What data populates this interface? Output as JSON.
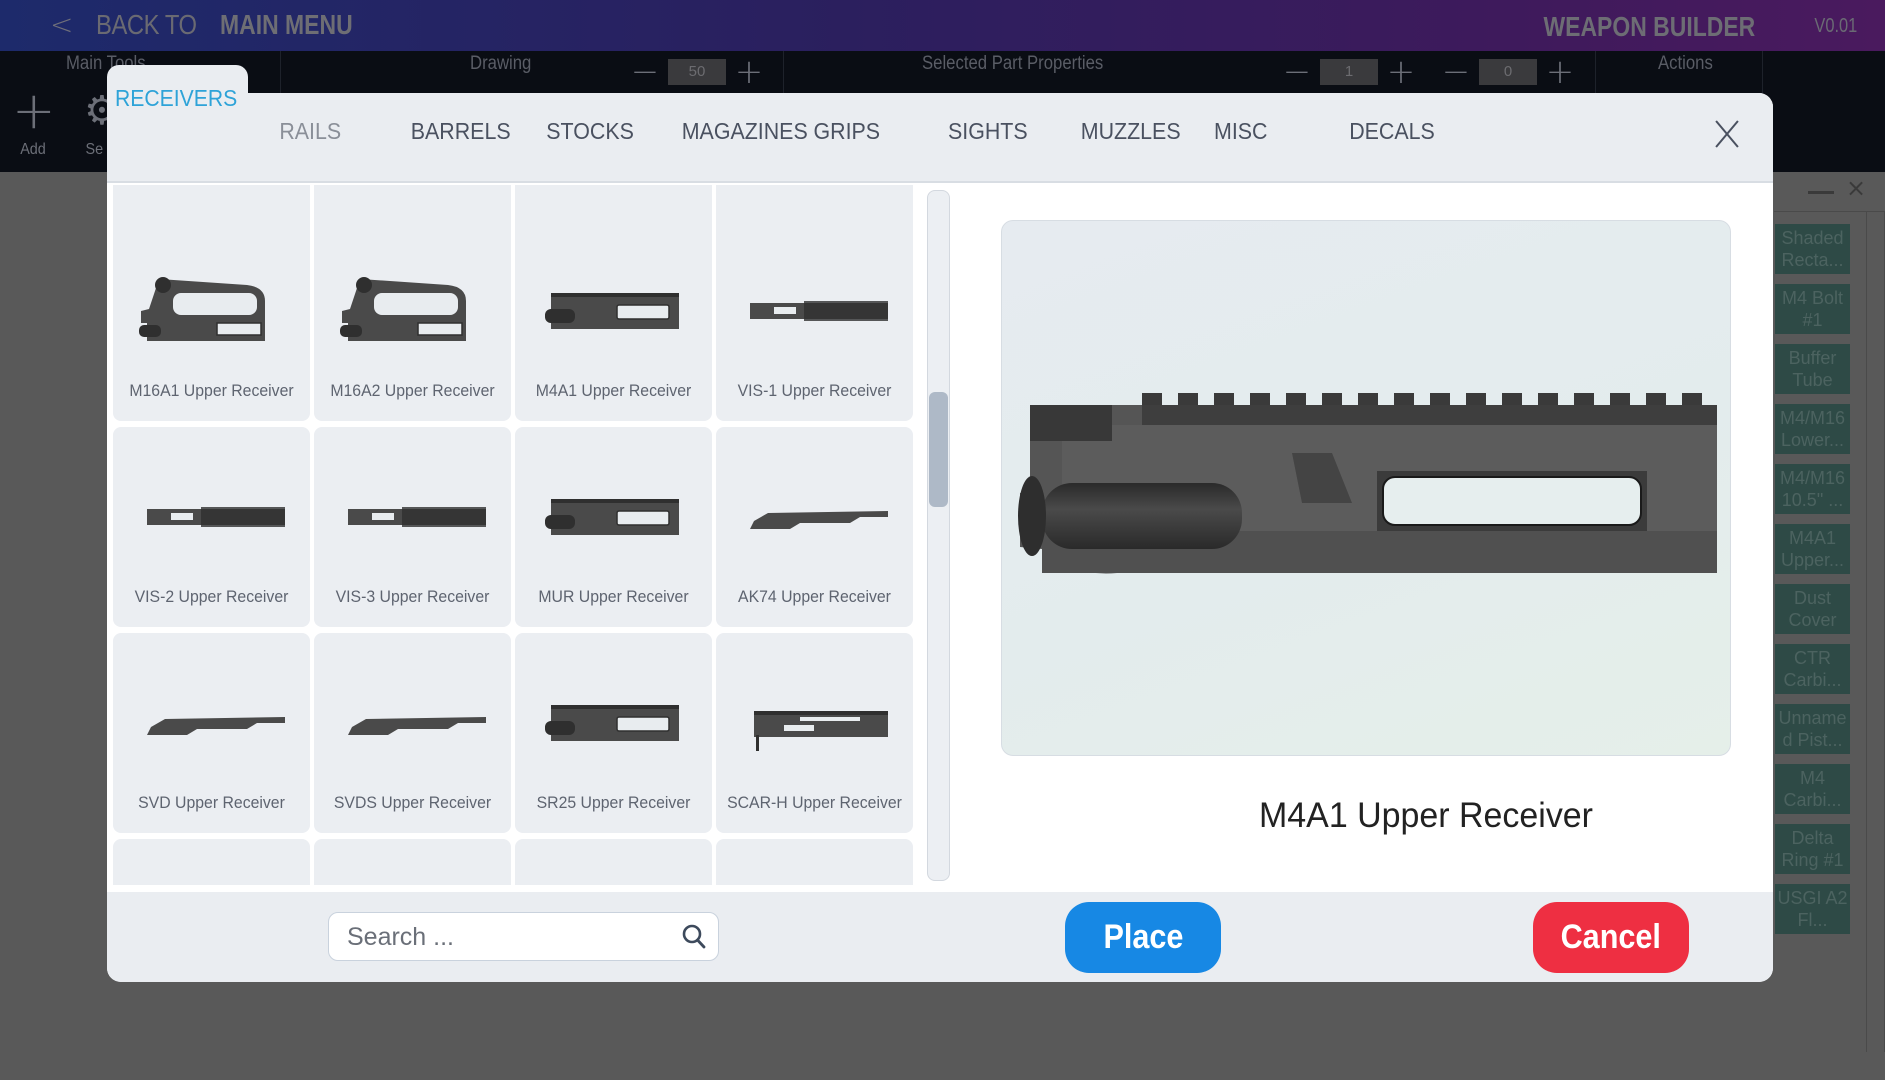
{
  "titlebar": {
    "back_glyph": "<",
    "back_to": "BACK TO",
    "main_menu": "MAIN MENU",
    "app_title": "WEAPON BUILDER",
    "version": "V0.01"
  },
  "toolbar": {
    "sections": {
      "main_tools": "Main Tools",
      "drawing": "Drawing",
      "selected_part_properties": "Selected Part Properties",
      "actions": "Actions"
    },
    "tools": [
      {
        "label": "Add",
        "icon": "plus-icon"
      },
      {
        "label": "Se",
        "icon": "gear-icon"
      }
    ],
    "drawing_stepper": {
      "minus": "−",
      "value": "50",
      "plus": "+"
    },
    "part_stepper_1": {
      "minus": "−",
      "value": "1",
      "plus": "+"
    },
    "part_stepper_2": {
      "minus": "−",
      "value": "0",
      "plus": "+"
    }
  },
  "right_panel": {
    "minimize_icon": "minimize-icon",
    "close_glyph": "×",
    "items": [
      "Shaded Recta...",
      "M4 Bolt #1",
      "Buffer Tube",
      "M4/M16 Lower...",
      "M4/M16 10.5\" ...",
      "M4A1 Upper...",
      "Dust Cover",
      "CTR Carbi...",
      "Unname d Pist...",
      "M4 Carbi...",
      "Delta Ring #1",
      "USGI A2 Fl..."
    ]
  },
  "modal": {
    "active_tab": "RECEIVERS",
    "tabs": [
      "RAILS",
      "BARRELS",
      "STOCKS",
      "MAGAZINES",
      "GRIPS",
      "SIGHTS",
      "MUZZLES",
      "MISC",
      "DECALS"
    ],
    "parts": [
      {
        "name": "M16A1 Upper Receiver",
        "shape": "carry-handle"
      },
      {
        "name": "M16A2 Upper Receiver",
        "shape": "carry-handle"
      },
      {
        "name": "M4A1 Upper Receiver",
        "shape": "flat-top"
      },
      {
        "name": "VIS-1 Upper Receiver",
        "shape": "long-rail"
      },
      {
        "name": "VIS-2 Upper Receiver",
        "shape": "long-rail"
      },
      {
        "name": "VIS-3 Upper Receiver",
        "shape": "long-rail"
      },
      {
        "name": "MUR Upper Receiver",
        "shape": "flat-top"
      },
      {
        "name": "AK74 Upper Receiver",
        "shape": "dust-cover"
      },
      {
        "name": "SVD Upper Receiver",
        "shape": "dust-cover"
      },
      {
        "name": "SVDS Upper Receiver",
        "shape": "dust-cover"
      },
      {
        "name": "SR25 Upper Receiver",
        "shape": "flat-top"
      },
      {
        "name": "SCAR-H Upper Receiver",
        "shape": "scar"
      }
    ],
    "selected_part": "M4A1 Upper Receiver",
    "scroll_position": 0.35,
    "search": {
      "placeholder": "Search ...",
      "value": ""
    },
    "place_label": "Place",
    "cancel_label": "Cancel",
    "colors": {
      "accent": "#2ea3d8",
      "place": "#1788e4",
      "cancel": "#ee2f42"
    }
  }
}
